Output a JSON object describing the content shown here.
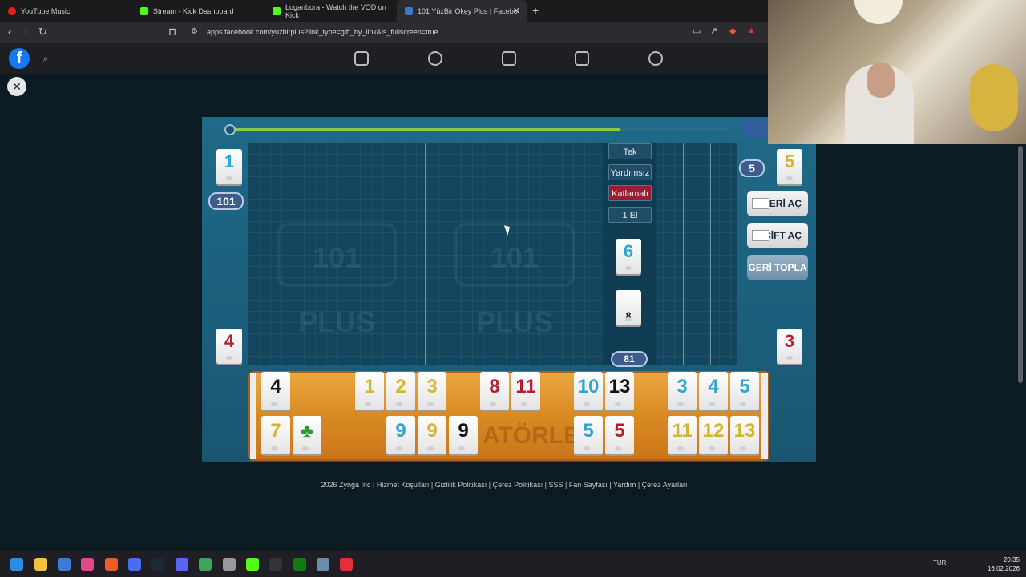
{
  "browser": {
    "tabs": [
      {
        "label": "YouTube Music",
        "color": "#e62117"
      },
      {
        "label": "Stream - Kick Dashboard",
        "color": "#53fc18"
      },
      {
        "label": "Loganbora - Watch the VOD on Kick",
        "color": "#53fc18"
      },
      {
        "label": "101 YüzBir Okey Plus | Facebo",
        "color": "#3b79c4"
      }
    ],
    "url": "apps.facebook.com/yuzbirplus?link_type=gift_by_link&is_fullscreen=true"
  },
  "game": {
    "player_scores": {
      "top_left": "1",
      "top_left_total": "101",
      "top_right_badge": "5",
      "top_right_tile": "5",
      "bottom_left": "4",
      "bottom_right": "3"
    },
    "options": [
      "Tek",
      "Yardımsız",
      "Katlamalı",
      "1 El"
    ],
    "selected_option": "Katlamalı",
    "center_tiles": {
      "indicator": "6",
      "draw_pile": "8",
      "remaining": "81"
    },
    "timer_fraction": 0.78,
    "watermark": "101 PLUS",
    "rack_watermark": "ATÖRLER",
    "actions": {
      "seri_ac": "SERİ AÇ",
      "cift_ac": "ÇİFT AÇ",
      "geri_topla": "GERİ TOPLA"
    },
    "rack_top": [
      {
        "v": "4",
        "c": "black"
      },
      {
        "v": "1",
        "c": "yellow"
      },
      {
        "v": "2",
        "c": "yellow"
      },
      {
        "v": "3",
        "c": "yellow"
      },
      {
        "v": "8",
        "c": "red"
      },
      {
        "v": "11",
        "c": "red"
      },
      {
        "v": "10",
        "c": "blue"
      },
      {
        "v": "13",
        "c": "black"
      },
      {
        "v": "3",
        "c": "blue"
      },
      {
        "v": "4",
        "c": "blue"
      },
      {
        "v": "5",
        "c": "blue"
      }
    ],
    "rack_bottom": [
      {
        "v": "7",
        "c": "yellow"
      },
      {
        "v": "♣",
        "c": "green"
      },
      {
        "v": "9",
        "c": "blue"
      },
      {
        "v": "9",
        "c": "yellow"
      },
      {
        "v": "9",
        "c": "black"
      },
      {
        "v": "5",
        "c": "blue"
      },
      {
        "v": "5",
        "c": "red"
      },
      {
        "v": "11",
        "c": "yellow"
      },
      {
        "v": "12",
        "c": "yellow"
      },
      {
        "v": "13",
        "c": "yellow"
      }
    ]
  },
  "footer": "2026 Zynga Inc | Hizmet Koşulları | Gizlilik Politikası | Çerez Politikası | SSS | Fan Sayfası | Yardım | Çerez Ayarları",
  "taskbar": {
    "lang": "TUR",
    "time": "20:35",
    "date": "16.02.2026"
  }
}
